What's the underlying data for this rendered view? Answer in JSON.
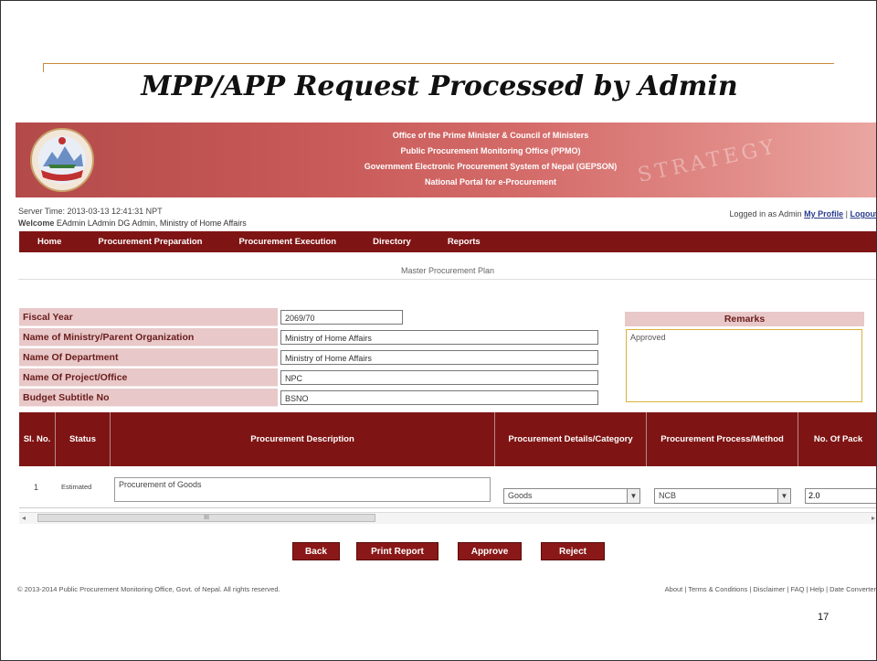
{
  "slide": {
    "title": "MPP/APP Request Processed by Admin",
    "page_number": "17"
  },
  "banner": {
    "line1": "Office of the Prime Minister & Council of Ministers",
    "line2": "Public Procurement Monitoring Office (PPMO)",
    "line3": "Government Electronic Procurement System of Nepal (GEPSON)",
    "line4": "National Portal for e-Procurement",
    "watermark": "STRATEGY"
  },
  "session": {
    "server_time": "Server Time:  2013-03-13 12:41:31 NPT",
    "welcome_prefix": "Welcome",
    "welcome_text": "EAdmin LAdmin  DG Admin,  Ministry of Home Affairs",
    "logged_in_as": "Logged in as  Admin",
    "my_profile": "My Profile",
    "separator": "|",
    "logout": "Logout"
  },
  "nav": [
    "Home",
    "Procurement Preparation",
    "Procurement Execution",
    "Directory",
    "Reports"
  ],
  "breadcrumb": "Master Procurement Plan",
  "form": {
    "fiscal_year": {
      "label": "Fiscal Year",
      "value": "2069/70"
    },
    "ministry": {
      "label": "Name of Ministry/Parent Organization",
      "value": "Ministry of Home Affairs"
    },
    "department": {
      "label": "Name Of Department",
      "value": "Ministry of Home Affairs"
    },
    "project": {
      "label": "Name Of Project/Office",
      "value": "NPC"
    },
    "budget": {
      "label": "Budget Subtitle No",
      "value": "BSNO"
    }
  },
  "remarks": {
    "label": "Remarks",
    "value": "Approved"
  },
  "table": {
    "headers": {
      "sl": "Sl. No.",
      "status": "Status",
      "description": "Procurement Description",
      "category": "Procurement Details/Category",
      "method": "Procurement Process/Method",
      "packages": "No. Of Pack"
    },
    "rows": [
      {
        "sl": "1",
        "status": "Estimated",
        "description": "Procurement of Goods",
        "category": "Goods",
        "method": "NCB",
        "packages": "2.0"
      }
    ],
    "scroll_label": "III",
    "scroll_left": "◂",
    "scroll_right": "▸"
  },
  "buttons": {
    "back": "Back",
    "print": "Print Report",
    "approve": "Approve",
    "reject": "Reject"
  },
  "footer": {
    "copyright": "© 2013-2014 Public Procurement Monitoring Office, Govt. of Nepal. All rights reserved.",
    "links": "About | Terms & Conditions | Disclaimer | FAQ | Help | Date Converter"
  },
  "colors": {
    "nav_bg": "#7f1414",
    "label_bg": "#e8c8c8",
    "banner_start": "#b34a4a",
    "accent": "#c98a3a"
  }
}
